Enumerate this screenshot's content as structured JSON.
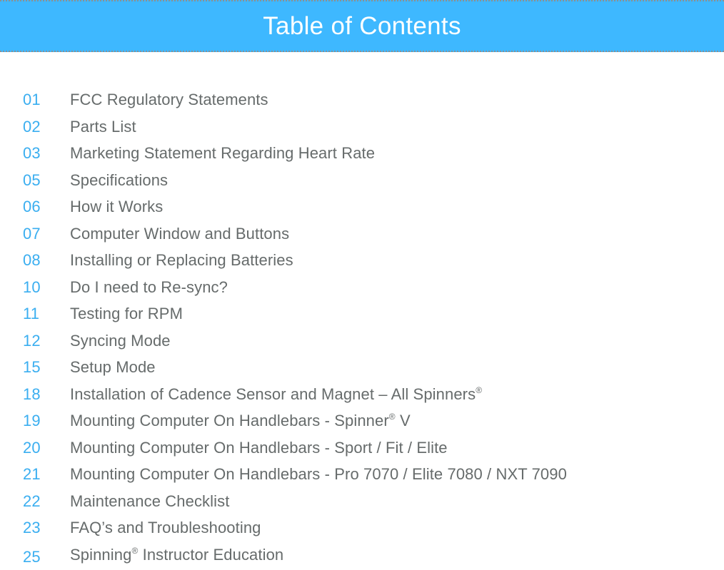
{
  "header": {
    "title": "Table of Contents",
    "background_color": "#3eb8ff",
    "border_color": "#8a8f92"
  },
  "colors": {
    "page_number": "#3aaef0",
    "entry_title": "#666b6b"
  },
  "toc": {
    "entries": [
      {
        "page": "01",
        "title": "FCC Regulatory Statements",
        "suffix_mark": "",
        "after_mark": ""
      },
      {
        "page": "02",
        "title": "Parts List",
        "suffix_mark": "",
        "after_mark": ""
      },
      {
        "page": "03",
        "title": "Marketing Statement Regarding Heart Rate",
        "suffix_mark": "",
        "after_mark": ""
      },
      {
        "page": "05",
        "title": "Specifications",
        "suffix_mark": "",
        "after_mark": ""
      },
      {
        "page": "06",
        "title": "How it Works",
        "suffix_mark": "",
        "after_mark": ""
      },
      {
        "page": "07",
        "title": "Computer Window and Buttons",
        "suffix_mark": "",
        "after_mark": ""
      },
      {
        "page": "08",
        "title": "Installing or Replacing Batteries",
        "suffix_mark": "",
        "after_mark": ""
      },
      {
        "page": "10",
        "title": "Do I need to Re-sync?",
        "suffix_mark": "",
        "after_mark": ""
      },
      {
        "page": "11",
        "title": "Testing for RPM",
        "suffix_mark": "",
        "after_mark": ""
      },
      {
        "page": "12",
        "title": "Syncing Mode",
        "suffix_mark": "",
        "after_mark": ""
      },
      {
        "page": "15",
        "title": "Setup Mode",
        "suffix_mark": "",
        "after_mark": ""
      },
      {
        "page": "18",
        "title": "Installation of Cadence Sensor and Magnet – All Spinners",
        "suffix_mark": "®",
        "after_mark": ""
      },
      {
        "page": "19",
        "title": "Mounting Computer On Handlebars - Spinner",
        "suffix_mark": "®",
        "after_mark": " V"
      },
      {
        "page": "20",
        "title": "Mounting Computer On Handlebars - Sport / Fit / Elite",
        "suffix_mark": "",
        "after_mark": ""
      },
      {
        "page": "21",
        "title": "Mounting Computer On Handlebars - Pro 7070 / Elite 7080 / NXT 7090",
        "suffix_mark": "",
        "after_mark": ""
      },
      {
        "page": "22",
        "title": "Maintenance Checklist",
        "suffix_mark": "",
        "after_mark": ""
      },
      {
        "page": "23",
        "title": "FAQ’s and Troubleshooting",
        "suffix_mark": "",
        "after_mark": ""
      },
      {
        "page": "25",
        "title": "Spinning",
        "suffix_mark": "®",
        "after_mark": " Instructor Education"
      }
    ]
  }
}
